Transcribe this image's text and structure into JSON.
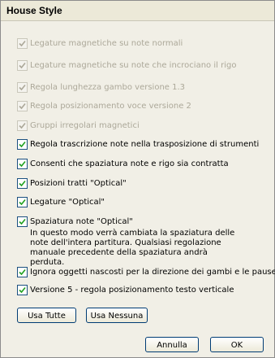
{
  "window": {
    "title": "House Style"
  },
  "options": [
    {
      "label": "Legature magnetiche su note normali",
      "checked": true,
      "enabled": false
    },
    {
      "label": "Legature magnetiche su note che incrociano il rigo",
      "checked": true,
      "enabled": false
    },
    {
      "label": "Regola lunghezza gambo versione 1.3",
      "checked": true,
      "enabled": false
    },
    {
      "label": "Regola posizionamento voce versione 2",
      "checked": true,
      "enabled": false
    },
    {
      "label": "Gruppi irregolari magnetici",
      "checked": true,
      "enabled": false
    },
    {
      "label": "Regola trascrizione note nella trasposizione di strumenti",
      "checked": true,
      "enabled": true
    },
    {
      "label": "Consenti che spaziatura note e rigo sia contratta",
      "checked": true,
      "enabled": true
    },
    {
      "label": "Posizioni tratti \"Optical\"",
      "checked": true,
      "enabled": true
    },
    {
      "label": "Legature \"Optical\"",
      "checked": true,
      "enabled": true
    },
    {
      "label": "Spaziatura note \"Optical\"",
      "checked": true,
      "enabled": true
    },
    {
      "label": "Ignora oggetti nascosti per la direzione dei gambi e le pause",
      "checked": true,
      "enabled": true
    },
    {
      "label": "Versione 5 - regola posizionamento testo verticale",
      "checked": true,
      "enabled": true
    }
  ],
  "optical_spacing_note": "In questo modo verrà cambiata la spaziatura delle note dell'intera partitura. Qualsiasi regolazione manuale precedente della spaziatura andrà perduta.",
  "buttons": {
    "use_all": "Usa Tutte",
    "use_none": "Usa Nessuna",
    "cancel": "Annulla",
    "ok": "OK"
  }
}
